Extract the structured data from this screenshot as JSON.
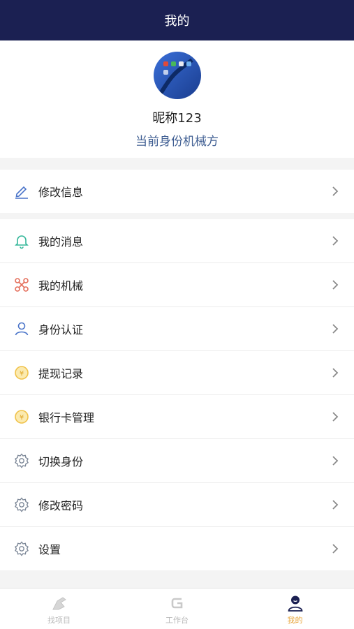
{
  "header": {
    "title": "我的"
  },
  "profile": {
    "nickname": "昵称123",
    "role": "当前身份机械方"
  },
  "menu_group_1": [
    {
      "label": "修改信息",
      "icon": "edit-icon"
    }
  ],
  "menu_group_2": [
    {
      "label": "我的消息",
      "icon": "bell-icon"
    },
    {
      "label": "我的机械",
      "icon": "machinery-icon"
    },
    {
      "label": "身份认证",
      "icon": "user-verify-icon"
    },
    {
      "label": "提现记录",
      "icon": "coin-icon"
    },
    {
      "label": "银行卡管理",
      "icon": "coin-icon"
    },
    {
      "label": "切换身份",
      "icon": "gear-icon"
    },
    {
      "label": "修改密码",
      "icon": "gear-icon"
    },
    {
      "label": "设置",
      "icon": "gear-icon"
    }
  ],
  "tabbar": {
    "tabs": [
      {
        "label": "找项目",
        "icon": "find-project-icon",
        "active": false
      },
      {
        "label": "工作台",
        "icon": "workbench-icon",
        "active": false
      },
      {
        "label": "我的",
        "icon": "profile-icon",
        "active": true
      }
    ]
  },
  "colors": {
    "header_bg": "#1b2052",
    "role_text": "#3f5e92",
    "active_tab": "#e8a63b"
  }
}
